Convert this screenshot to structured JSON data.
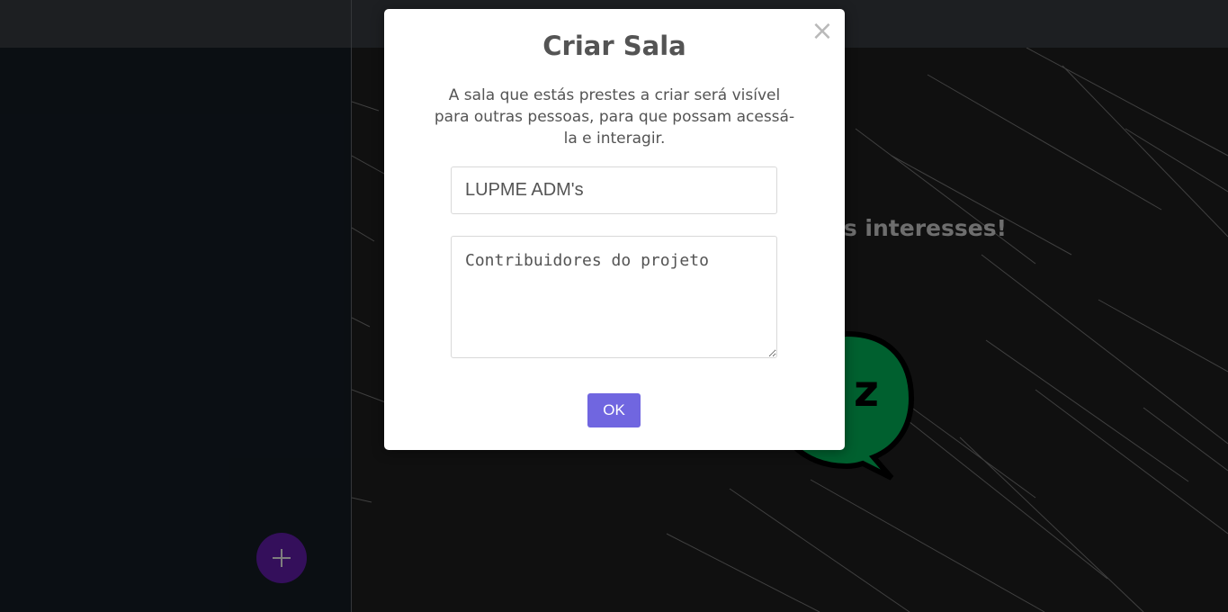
{
  "background": {
    "welcome_text": "us interesses!",
    "mascot_text": "z"
  },
  "sidebar": {
    "add_button_icon": "plus-icon"
  },
  "modal": {
    "title": "Criar Sala",
    "description": "A sala que estás prestes a criar será visível para outras pessoas, para que possam acessá-la e interagir.",
    "close_symbol": "×",
    "room_name_value": "LUPME ADM's",
    "room_description_value": "Contribuidores do projeto",
    "ok_label": "OK"
  },
  "colors": {
    "accent_button": "#7066e0",
    "fab": "#5a1a9e",
    "mascot_green": "#00a651"
  }
}
